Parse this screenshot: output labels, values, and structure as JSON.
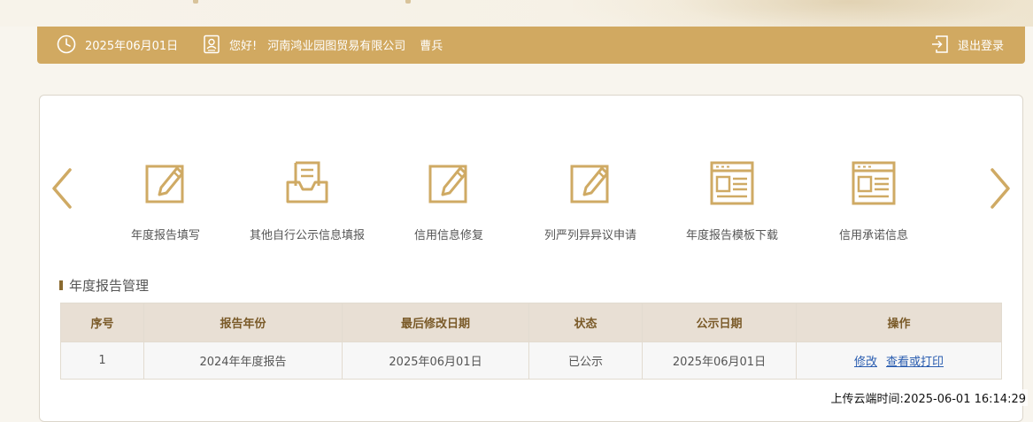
{
  "header": {
    "date": "2025年06月01日",
    "greeting": "您好!",
    "company": "河南鸿业园图贸易有限公司",
    "user": "曹兵",
    "logout_label": "退出登录"
  },
  "colors": {
    "accent": "#d1a961",
    "accent_dark": "#8a6a2f",
    "link": "#2a5db0",
    "header_row": "#e8dfd4"
  },
  "menu": {
    "items": [
      {
        "label": "年度报告填写",
        "icon": "edit-icon"
      },
      {
        "label": "其他自行公示信息填报",
        "icon": "inbox-document-icon"
      },
      {
        "label": "信用信息修复",
        "icon": "edit-icon"
      },
      {
        "label": "列严列异异议申请",
        "icon": "edit-icon"
      },
      {
        "label": "年度报告模板下载",
        "icon": "template-icon"
      },
      {
        "label": "信用承诺信息",
        "icon": "template-icon"
      }
    ]
  },
  "section": {
    "title": "年度报告管理"
  },
  "table": {
    "headers": [
      "序号",
      "报告年份",
      "最后修改日期",
      "状态",
      "公示日期",
      "操作"
    ],
    "rows": [
      {
        "index": "1",
        "year": "2024年年度报告",
        "modified": "2025年06月01日",
        "status": "已公示",
        "published": "2025年06月01日",
        "action_edit": "修改",
        "action_view": "查看或打印"
      }
    ]
  },
  "footer": {
    "upload_time": "上传云端时间:2025-06-01 16:14:29"
  }
}
